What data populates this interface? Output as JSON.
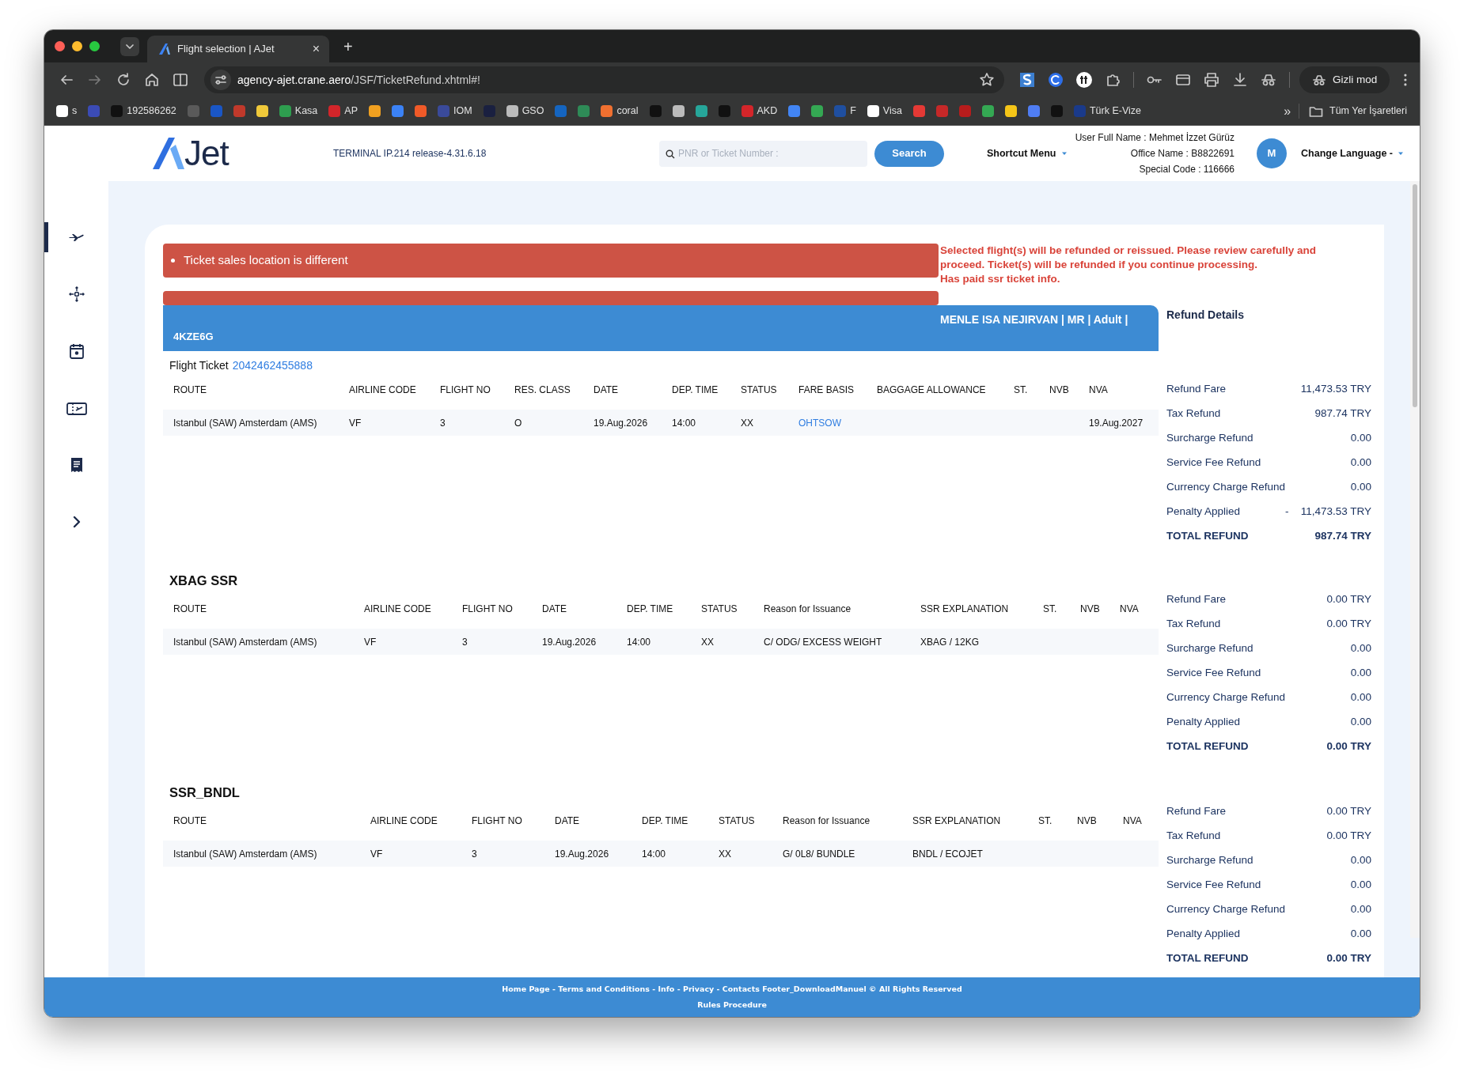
{
  "browser": {
    "tab_title": "Flight selection | AJet",
    "tab_close": "×",
    "new_tab": "+",
    "url_host": "agency-ajet.crane.aero",
    "url_path": "/JSF/TicketRefund.xhtml#!",
    "profile": "Gizli mod",
    "bookmarks": [
      {
        "label": "s",
        "color": "#ffffff"
      },
      {
        "color": "#3b4bb5"
      },
      {
        "label": "192586262",
        "color": "#111111"
      },
      {
        "color": "#5a5a5a"
      },
      {
        "color": "#1a56c5"
      },
      {
        "color": "#c0392b"
      },
      {
        "color": "#f0c93a"
      },
      {
        "label": "Kasa",
        "color": "#2e9e4f"
      },
      {
        "label": "AP",
        "color": "#d3252a"
      },
      {
        "color": "#f0a020"
      },
      {
        "color": "#3b82f6"
      },
      {
        "color": "#f05a28"
      },
      {
        "label": "IOM",
        "color": "#3a4a9a"
      },
      {
        "color": "#1a2040"
      },
      {
        "label": "GSO",
        "color": "#bbbbbb"
      },
      {
        "color": "#1565c0"
      },
      {
        "color": "#2e8b57"
      },
      {
        "label": "coral",
        "color": "#f07030"
      },
      {
        "color": "#111111"
      },
      {
        "color": "#bbbbbb"
      },
      {
        "color": "#26a69a"
      },
      {
        "color": "#111111"
      },
      {
        "label": "AKD",
        "color": "#d3252a"
      },
      {
        "color": "#4285f4"
      },
      {
        "color": "#34a853"
      },
      {
        "label": "F",
        "color": "#1f4fa0"
      },
      {
        "label": "Visa",
        "color": "#ffffff"
      },
      {
        "color": "#e53935"
      },
      {
        "color": "#c62828"
      },
      {
        "color": "#b71c1c"
      },
      {
        "color": "#34a853"
      },
      {
        "color": "#f5c518"
      },
      {
        "color": "#4f7df3"
      },
      {
        "color": "#111111"
      },
      {
        "label": "Türk E-Vize",
        "color": "#1a3a8a"
      }
    ],
    "bookmarks_more": "»",
    "all_bookmarks": "Tüm Yer İşaretleri"
  },
  "header": {
    "logo_text": "Jet",
    "terminal": "TERMINAL IP.214 release-4.31.6.18",
    "search": {
      "placeholder": "PNR or Ticket Number :"
    },
    "search_button": "Search",
    "shortcut_menu": "Shortcut Menu",
    "user_lines": [
      "User Full Name : Mehmet İzzet Gürüz",
      "Office Name : B8822691",
      "Special Code : 116666"
    ],
    "avatar": "M",
    "language": "Change Language -"
  },
  "sidebar": {
    "items": [
      {
        "selected": true
      },
      {
        "selected": false
      },
      {
        "selected": false
      },
      {
        "selected": false
      },
      {
        "selected": false
      },
      {
        "selected": false
      }
    ]
  },
  "alerts": [
    {
      "kind": "message",
      "text": "Ticket sales location is different"
    },
    {
      "kind": "empty"
    }
  ],
  "warning": [
    "Selected flight(s) will be refunded or reissued. Please review carefully and proceed. Ticket(s) will be refunded if you continue processing.",
    "Has paid ssr ticket info."
  ],
  "passenger": {
    "name": "MENLE ISA NEJIRVAN | MR | Adult |",
    "pnr": "4KZE6G"
  },
  "refund_details_title": "Refund Details",
  "sections": [
    {
      "kind": "ticket",
      "label": "Flight Ticket",
      "ticket_number": "2042462455888",
      "columns": [
        {
          "label": "ROUTE",
          "kind": "text",
          "values": [
            "Istanbul (SAW) Amsterdam (AMS)"
          ]
        },
        {
          "label": "AIRLINE CODE",
          "kind": "text",
          "values": [
            "VF"
          ]
        },
        {
          "label": "FLIGHT NO",
          "kind": "text",
          "values": [
            "3"
          ]
        },
        {
          "label": "RES. CLASS",
          "kind": "text",
          "values": [
            "O"
          ]
        },
        {
          "label": "DATE",
          "kind": "text",
          "values": [
            "19.Aug.2026"
          ]
        },
        {
          "label": "DEP. TIME",
          "kind": "text",
          "values": [
            "14:00"
          ]
        },
        {
          "label": "STATUS",
          "kind": "text",
          "values": [
            "XX"
          ]
        },
        {
          "label": "FARE BASIS",
          "kind": "link",
          "values": [
            "OHTSOW"
          ]
        },
        {
          "label": "BAGGAGE ALLOWANCE"
        },
        {
          "label": "ST."
        },
        {
          "label": "NVB"
        },
        {
          "label": "NVA",
          "kind": "text",
          "values": [
            "19.Aug.2027"
          ]
        }
      ],
      "refund": [
        {
          "kind": "line",
          "label": "Refund Fare",
          "value": "11,473.53 TRY"
        },
        {
          "kind": "line",
          "label": "Tax Refund",
          "value": "987.74 TRY"
        },
        {
          "kind": "line",
          "label": "Surcharge Refund",
          "value": "0.00"
        },
        {
          "kind": "line",
          "label": "Service Fee Refund",
          "value": "0.00"
        },
        {
          "kind": "line",
          "label": "Currency Charge Refund",
          "value": "0.00"
        },
        {
          "kind": "line",
          "label": "Penalty Applied",
          "sign": "-",
          "value": "11,473.53 TRY"
        },
        {
          "kind": "total",
          "label": "TOTAL REFUND",
          "value": "987.74 TRY"
        }
      ]
    },
    {
      "kind": "ssr",
      "title": "XBAG SSR",
      "columns": [
        {
          "label": "ROUTE",
          "kind": "text",
          "values": [
            "Istanbul (SAW) Amsterdam (AMS)"
          ]
        },
        {
          "label": "AIRLINE CODE",
          "kind": "text",
          "values": [
            "VF"
          ]
        },
        {
          "label": "FLIGHT NO",
          "kind": "text",
          "values": [
            "3"
          ]
        },
        {
          "label": "DATE",
          "kind": "text",
          "values": [
            "19.Aug.2026"
          ]
        },
        {
          "label": "DEP. TIME",
          "kind": "text",
          "values": [
            "14:00"
          ]
        },
        {
          "label": "STATUS",
          "kind": "text",
          "values": [
            "XX"
          ]
        },
        {
          "label": "Reason for Issuance",
          "kind": "text",
          "values": [
            "C/ ODG/ EXCESS WEIGHT"
          ]
        },
        {
          "label": "SSR EXPLANATION",
          "kind": "text",
          "values": [
            "XBAG / 12KG"
          ]
        },
        {
          "label": "ST."
        },
        {
          "label": "NVB"
        },
        {
          "label": "NVA"
        }
      ],
      "refund": [
        {
          "kind": "line",
          "label": "Refund Fare",
          "value": "0.00 TRY"
        },
        {
          "kind": "line",
          "label": "Tax Refund",
          "value": "0.00 TRY"
        },
        {
          "kind": "line",
          "label": "Surcharge Refund",
          "value": "0.00"
        },
        {
          "kind": "line",
          "label": "Service Fee Refund",
          "value": "0.00"
        },
        {
          "kind": "line",
          "label": "Currency Charge Refund",
          "value": "0.00"
        },
        {
          "kind": "line",
          "label": "Penalty Applied",
          "value": "0.00"
        },
        {
          "kind": "total",
          "label": "TOTAL REFUND",
          "value": "0.00 TRY"
        }
      ]
    },
    {
      "kind": "ssr",
      "title": "SSR_BNDL",
      "columns": [
        {
          "label": "ROUTE",
          "kind": "text",
          "values": [
            "Istanbul (SAW) Amsterdam (AMS)"
          ]
        },
        {
          "label": "AIRLINE CODE",
          "kind": "text",
          "values": [
            "VF"
          ]
        },
        {
          "label": "FLIGHT NO",
          "kind": "text",
          "values": [
            "3"
          ]
        },
        {
          "label": "DATE",
          "kind": "text",
          "values": [
            "19.Aug.2026"
          ]
        },
        {
          "label": "DEP. TIME",
          "kind": "text",
          "values": [
            "14:00"
          ]
        },
        {
          "label": "STATUS",
          "kind": "text",
          "values": [
            "XX"
          ]
        },
        {
          "label": "Reason for Issuance",
          "kind": "text",
          "values": [
            "G/ 0L8/ BUNDLE"
          ]
        },
        {
          "label": "SSR EXPLANATION",
          "kind": "text",
          "values": [
            "BNDL / ECOJET"
          ]
        },
        {
          "label": "ST."
        },
        {
          "label": "NVB"
        },
        {
          "label": "NVA"
        }
      ],
      "refund": [
        {
          "kind": "line",
          "label": "Refund Fare",
          "value": "0.00 TRY"
        },
        {
          "kind": "line",
          "label": "Tax Refund",
          "value": "0.00 TRY"
        },
        {
          "kind": "line",
          "label": "Surcharge Refund",
          "value": "0.00"
        },
        {
          "kind": "line",
          "label": "Service Fee Refund",
          "value": "0.00"
        },
        {
          "kind": "line",
          "label": "Currency Charge Refund",
          "value": "0.00"
        },
        {
          "kind": "line",
          "label": "Penalty Applied",
          "value": "0.00"
        },
        {
          "kind": "total",
          "label": "TOTAL REFUND",
          "value": "0.00 TRY"
        }
      ]
    }
  ],
  "footer": [
    "Home Page - Terms and Conditions - Info - Privacy - Contacts Footer_DownloadManuel © All Rights Reserved",
    "Rules Procedure"
  ]
}
